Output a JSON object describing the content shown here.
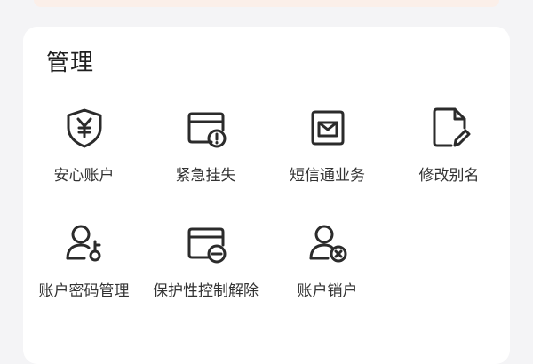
{
  "section": {
    "title": "管理"
  },
  "items": [
    {
      "label": "安心账户",
      "icon": "shield-yen-icon"
    },
    {
      "label": "紧急挂失",
      "icon": "card-alert-icon"
    },
    {
      "label": "短信通业务",
      "icon": "sms-mail-icon"
    },
    {
      "label": "修改别名",
      "icon": "edit-document-icon"
    },
    {
      "label": "账户密码管理",
      "icon": "user-key-icon"
    },
    {
      "label": "保护性控制解除",
      "icon": "card-minus-icon"
    },
    {
      "label": "账户销户",
      "icon": "user-remove-icon"
    }
  ],
  "colors": {
    "background": "#f4f4f6",
    "card": "#ffffff",
    "icon_stroke": "#2b2b2b",
    "text": "#333333"
  }
}
